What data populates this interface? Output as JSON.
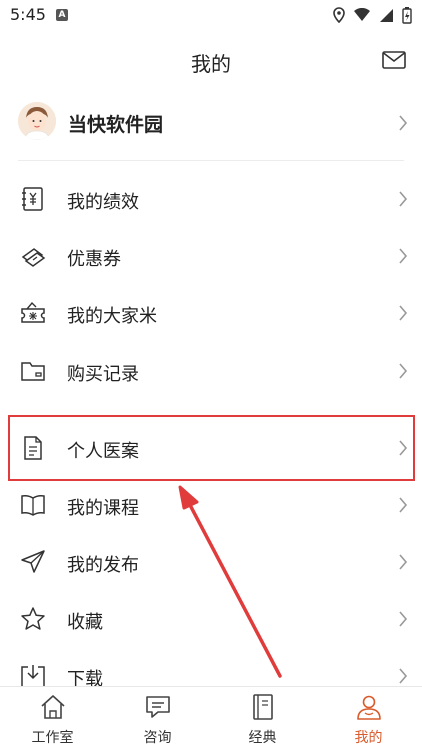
{
  "status": {
    "time": "5:45",
    "badge": "A"
  },
  "header": {
    "title": "我的"
  },
  "profile": {
    "name": "当快软件园"
  },
  "menu": [
    {
      "label": "我的绩效",
      "icon": "ledger-yen-icon"
    },
    {
      "label": "优惠券",
      "icon": "coupon-icon"
    },
    {
      "label": "我的大家米",
      "icon": "rice-ticket-icon"
    },
    {
      "label": "购买记录",
      "icon": "wallet-icon"
    },
    {
      "label": "个人医案",
      "icon": "document-icon"
    },
    {
      "label": "我的课程",
      "icon": "book-icon"
    },
    {
      "label": "我的发布",
      "icon": "send-icon"
    },
    {
      "label": "收藏",
      "icon": "star-icon"
    },
    {
      "label": "下载",
      "icon": "download-icon"
    }
  ],
  "tabs": [
    {
      "label": "工作室",
      "icon": "house-icon",
      "active": false
    },
    {
      "label": "咨询",
      "icon": "chat-icon",
      "active": false
    },
    {
      "label": "经典",
      "icon": "classic-book-icon",
      "active": false
    },
    {
      "label": "我的",
      "icon": "person-icon",
      "active": true
    }
  ],
  "colors": {
    "accent": "#d95a2b",
    "highlight": "#e03c3c",
    "text": "#222222"
  }
}
